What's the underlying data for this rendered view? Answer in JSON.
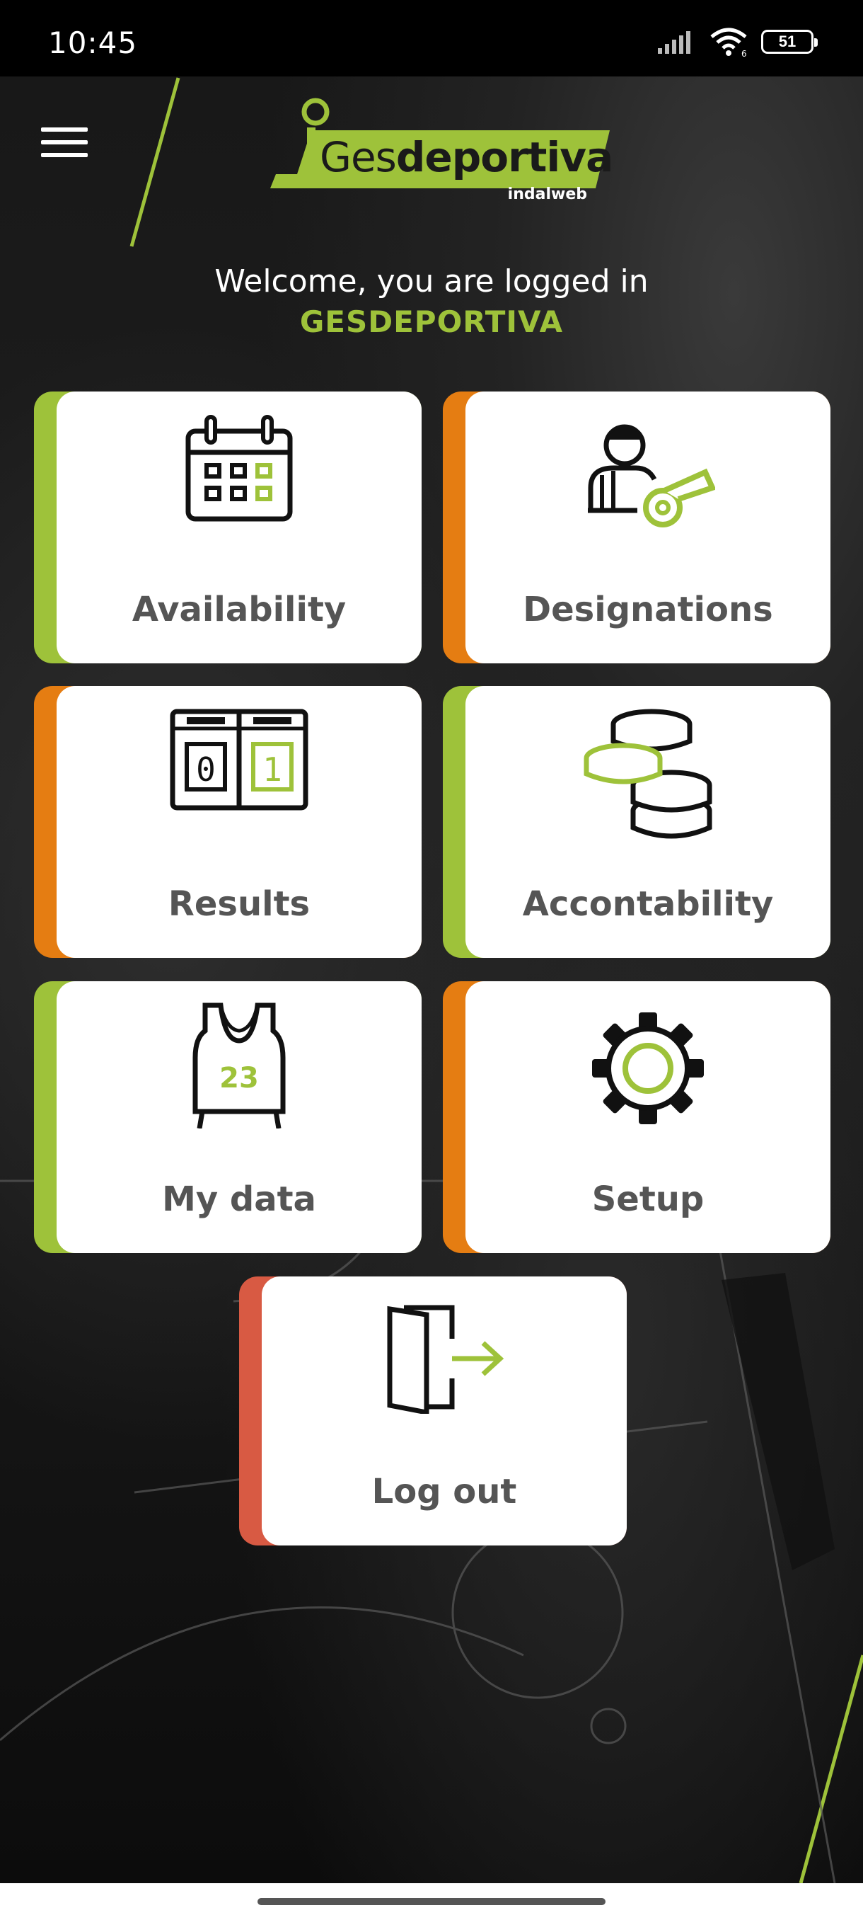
{
  "status_bar": {
    "time": "10:45",
    "battery": "51"
  },
  "header": {
    "menu_icon": "hamburger-menu-icon",
    "logo_prefix": "Ges",
    "logo_main": "deportiva",
    "logo_sub": "indalweb"
  },
  "welcome": {
    "message": "Welcome, you are logged in",
    "username": "GESDEPORTIVA"
  },
  "tiles": [
    {
      "label": "Availability",
      "icon": "calendar-icon",
      "accent": "#9ec23a"
    },
    {
      "label": "Designations",
      "icon": "referee-whistle-icon",
      "accent": "#e57d12"
    },
    {
      "label": "Results",
      "icon": "scoreboard-icon",
      "accent": "#e57d12"
    },
    {
      "label": "Accontability",
      "icon": "coins-icon",
      "accent": "#9ec23a"
    },
    {
      "label": "My data",
      "icon": "jersey-icon",
      "accent": "#9ec23a"
    },
    {
      "label": "Setup",
      "icon": "gear-icon",
      "accent": "#e57d12"
    },
    {
      "label": "Log out",
      "icon": "logout-door-icon",
      "accent": "#d85a43"
    }
  ],
  "jersey_number": "23",
  "scoreboard": {
    "home": "0",
    "away": "1"
  },
  "colors": {
    "brand_green": "#9ec23a",
    "accent_orange": "#e57d12",
    "logout_red": "#d85a43"
  }
}
